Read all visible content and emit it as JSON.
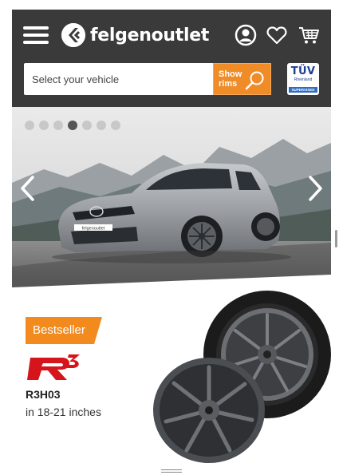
{
  "header": {
    "brand": "felgenoutlet",
    "search_placeholder": "Select your vehicle",
    "show_rims_label": "Show rims",
    "tuv": {
      "title": "TÜV",
      "sub": "Rheinland",
      "band": "SUPERVISED"
    }
  },
  "slider": {
    "dots_count": 7,
    "active_dot": 3,
    "car_plate": "felgenoutlet"
  },
  "promo": {
    "badge": "Bestseller",
    "brand_mark": "R3",
    "product_name": "R3H03",
    "sizes": "in 18-21 inches"
  },
  "colors": {
    "header_bg": "#3a3a3a",
    "accent_orange": "#f08c28",
    "badge_orange": "#f28a1e",
    "brand_red": "#d6141c"
  },
  "icons": [
    "menu-icon",
    "logo-icon",
    "account-icon",
    "heart-icon",
    "cart-icon",
    "search-icon",
    "chevron-left-icon",
    "chevron-right-icon"
  ]
}
